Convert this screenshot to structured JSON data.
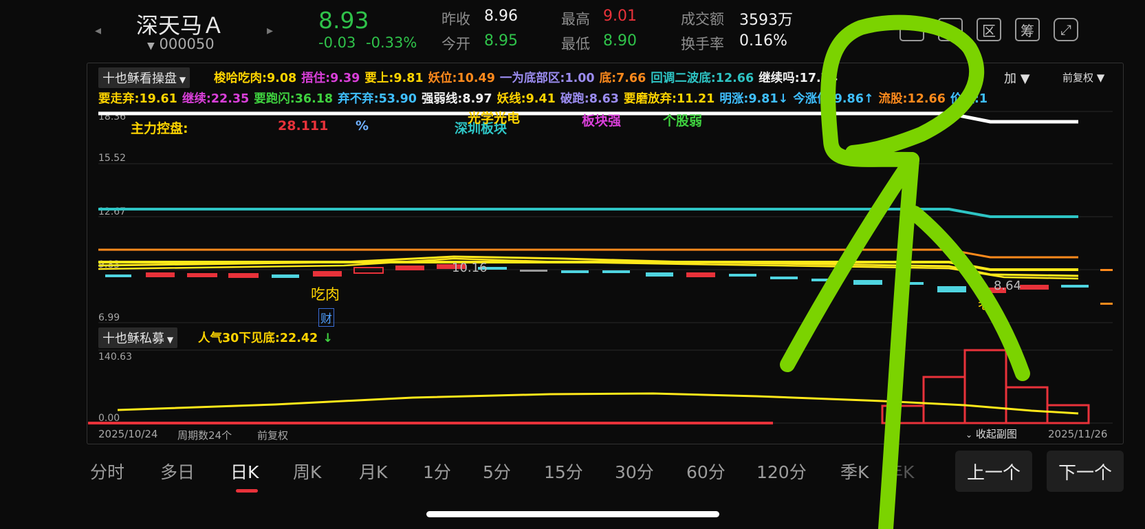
{
  "header": {
    "name": "深天马Ａ",
    "code": "000050",
    "price": "8.93",
    "change": "-0.03",
    "change_pct": "-0.33%",
    "quote": [
      {
        "label": "昨收",
        "value": "8.96",
        "color": "white"
      },
      {
        "label": "今开",
        "value": "8.95",
        "color": "green"
      },
      {
        "label": "最高",
        "value": "9.01",
        "color": "red"
      },
      {
        "label": "最低",
        "value": "8.90",
        "color": "green"
      },
      {
        "label": "成交额",
        "value": "3593万",
        "color": "white"
      },
      {
        "label": "换手率",
        "value": "0.16%",
        "color": "white"
      }
    ],
    "tools": [
      "区",
      "筹"
    ]
  },
  "main_panel": {
    "dropdown": "十也稣看操盘",
    "add_label": "加",
    "adjust_label": "前复权",
    "row1": [
      {
        "text": "梭哈吃肉:9.08",
        "color": "#ffd400"
      },
      {
        "text": "捂住:9.39",
        "color": "#d93fd9"
      },
      {
        "text": "要上:9.81",
        "color": "#ffd400"
      },
      {
        "text": "妖位:10.49",
        "color": "#ff8a1c"
      },
      {
        "text": "一为底部区:1.00",
        "color": "#9b8cf0"
      },
      {
        "text": "底:7.66",
        "color": "#ff8a1c"
      },
      {
        "text": "回调二波底:12.66",
        "color": "#2ec4c4"
      },
      {
        "text": "继续吗:17.74",
        "color": "#f0f0f0"
      }
    ],
    "row2": [
      {
        "text": "要走弃:19.61",
        "color": "#ffd400"
      },
      {
        "text": "继续:22.35",
        "color": "#d93fd9"
      },
      {
        "text": "要跑闪:36.18",
        "color": "#3fd13f"
      },
      {
        "text": "弃不弃:53.90",
        "color": "#3fbfff"
      },
      {
        "text": "强弱线:8.97",
        "color": "#f0f0f0"
      },
      {
        "text": "妖线:9.41",
        "color": "#ffd400"
      },
      {
        "text": "破跑:8.63",
        "color": "#9b8cf0"
      },
      {
        "text": "要磨放弃:11.21",
        "color": "#ffd400"
      },
      {
        "text": "明涨:9.81↓",
        "color": "#3fbfff"
      },
      {
        "text": "今涨停:9.86↑",
        "color": "#3fbfff"
      },
      {
        "text": "流股:12.66",
        "color": "#ff8a1c"
      },
      {
        "text": "价值:1",
        "color": "#3fbfff"
      }
    ],
    "y_ticks": [
      "18.36",
      "15.52",
      "12.67",
      "9.83",
      "6.99"
    ],
    "overlay": [
      {
        "text": "主力控盘:",
        "color": "#ffd400"
      },
      {
        "text": "28.111",
        "color": "#e8323a"
      },
      {
        "text": "%",
        "color": "#6fb0ff"
      },
      {
        "text": "深圳板块",
        "color": "#2ec4c4"
      },
      {
        "text": "光学光电",
        "color": "#ffd400"
      },
      {
        "text": "板块强",
        "color": "#d93fd9"
      },
      {
        "text": "个股弱",
        "color": "#3fd13f"
      }
    ],
    "annotations": {
      "chirou": "吃肉",
      "cai": "财",
      "price_high": "10.16",
      "price_low": "8.64",
      "lao": "老"
    }
  },
  "sub_panel": {
    "dropdown": "十也稣私募",
    "indicator": "人气30下见底:22.42",
    "arrow": "↓",
    "y_ticks": [
      "140.63",
      "0.00"
    ],
    "collapse_label": "收起副图"
  },
  "footer_info": {
    "start_date": "2025/10/24",
    "period": "周期数24个",
    "adjust": "前复权",
    "end_date": "2025/11/26"
  },
  "tabs": [
    "分时",
    "多日",
    "日K",
    "周K",
    "月K",
    "1分",
    "5分",
    "15分",
    "30分",
    "60分",
    "120分",
    "季K",
    "年K"
  ],
  "active_tab": "日K",
  "buttons": {
    "prev": "上一个",
    "next": "下一个"
  }
}
